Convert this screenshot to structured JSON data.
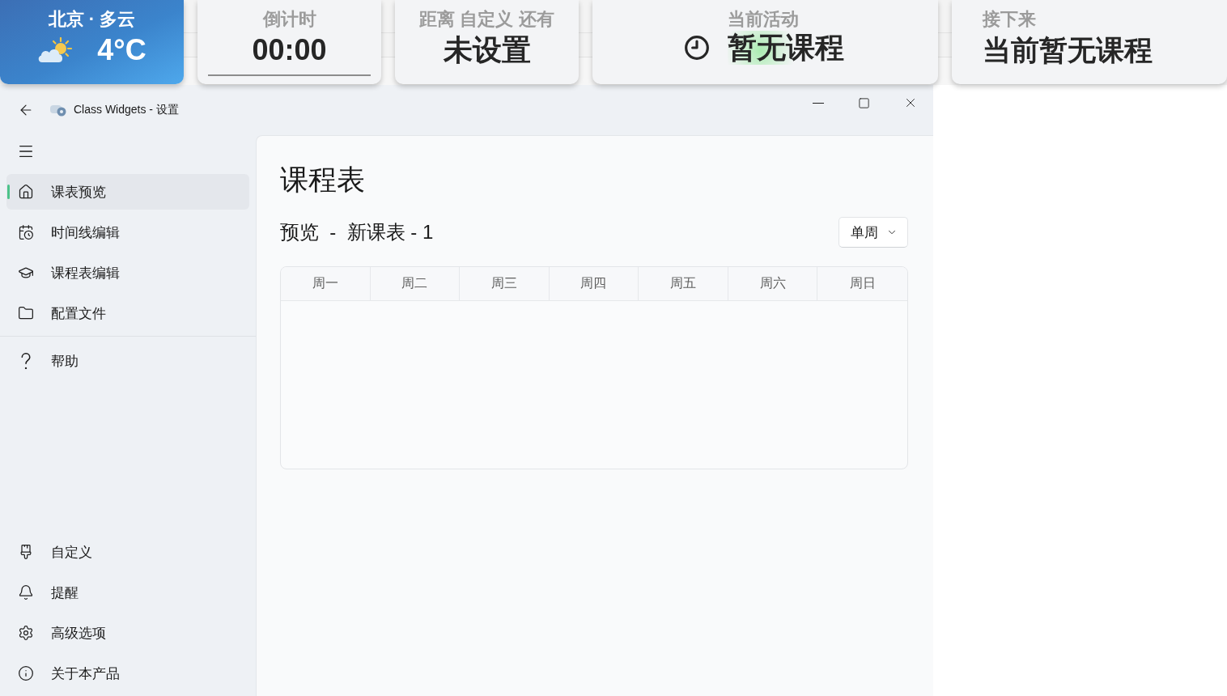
{
  "widgets": [
    {
      "kind": "weather",
      "title": "北京 · 多云",
      "value": "4°C"
    },
    {
      "kind": "countdown",
      "title": "倒计时",
      "value": "00:00"
    },
    {
      "kind": "plain",
      "title": "距离 自定义 还有",
      "value": "未设置"
    },
    {
      "kind": "activity",
      "title": "当前活动",
      "value": "暂无课程"
    },
    {
      "kind": "next",
      "title": "接下来",
      "value": "当前暂无课程"
    }
  ],
  "window": {
    "title": "Class Widgets - 设置"
  },
  "sidebar": {
    "items": [
      {
        "label": "课表预览",
        "selected": true
      },
      {
        "label": "时间线编辑",
        "selected": false
      },
      {
        "label": "课程表编辑",
        "selected": false
      },
      {
        "label": "配置文件",
        "selected": false
      }
    ],
    "middle_items": [
      {
        "label": "帮助",
        "selected": false
      }
    ],
    "bottom_items": [
      {
        "label": "自定义",
        "selected": false
      },
      {
        "label": "提醒",
        "selected": false
      },
      {
        "label": "高级选项",
        "selected": false
      },
      {
        "label": "关于本产品",
        "selected": false
      }
    ]
  },
  "page": {
    "title": "课程表",
    "subtitle": "预览  -  新课表 - 1",
    "week_select": {
      "value": "单周"
    },
    "table": {
      "columns": [
        "周一",
        "周二",
        "周三",
        "周四",
        "周五",
        "周六",
        "周日"
      ]
    }
  }
}
